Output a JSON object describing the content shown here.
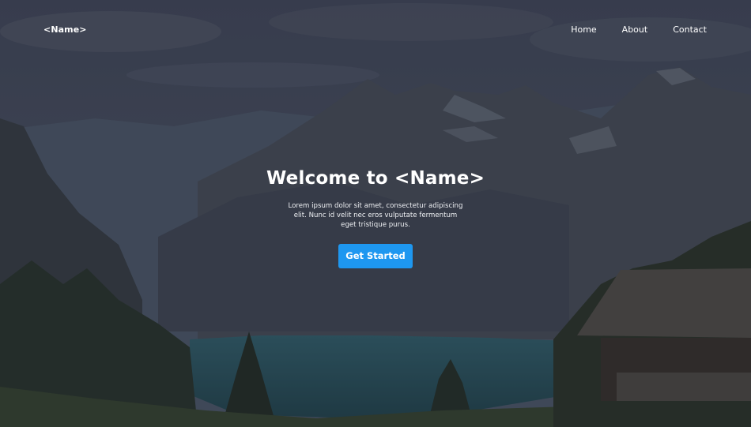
{
  "nav": {
    "brand": "<Name>",
    "links": [
      "Home",
      "About",
      "Contact"
    ]
  },
  "hero": {
    "title": "Welcome to <Name>",
    "subtitle": "Lorem ipsum dolor sit amet, consectetur adipiscing elit. Nunc id velit nec eros vulputate fermentum eget tristique purus.",
    "cta_label": "Get Started",
    "background_image": "mountain-lake-landscape"
  },
  "colors": {
    "accent": "#1e97f0",
    "overlay": "#2e3442",
    "text": "#ffffff"
  }
}
